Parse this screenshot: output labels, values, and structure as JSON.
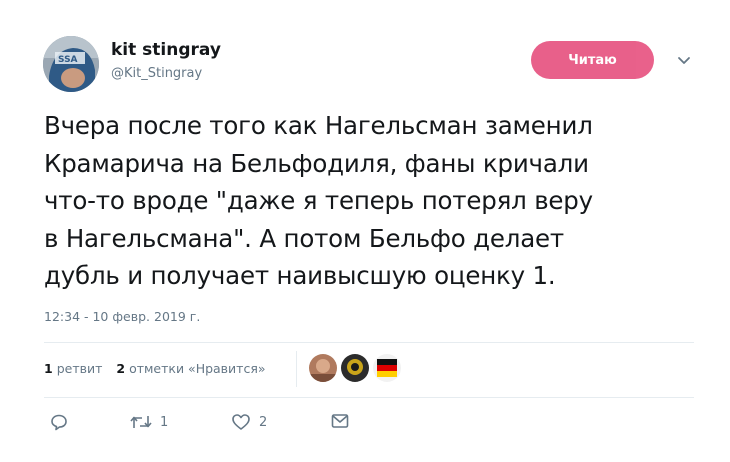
{
  "tweet": {
    "display_name": "kit stingray",
    "handle": "@Kit_Stingray",
    "follow_label": "Читаю",
    "text": "Вчера после того как Нагельсман заменил\nКрамарича на Бельфодиля, фаны кричали\nчто-то вроде \"даже я теперь потерял веру\nв Нагельсмана\". А потом Бельфо делает\nдубль и получает наивысшую оценку 1.",
    "timestamp": "12:34 - 10 февр. 2019 г."
  },
  "stats": {
    "retweets_count": "1",
    "retweets_label": "ретвит",
    "likes_count": "2",
    "likes_label": "отметки «Нравится»"
  },
  "actions": {
    "reply_icon": "reply-icon",
    "retweet_icon": "retweet-icon",
    "retweet_count": "1",
    "like_icon": "heart-icon",
    "like_count": "2",
    "dm_icon": "envelope-icon"
  },
  "colors": {
    "follow_button": "#e0245e",
    "text_primary": "#14171a",
    "text_secondary": "#657786",
    "divider": "#e6ecf0"
  }
}
